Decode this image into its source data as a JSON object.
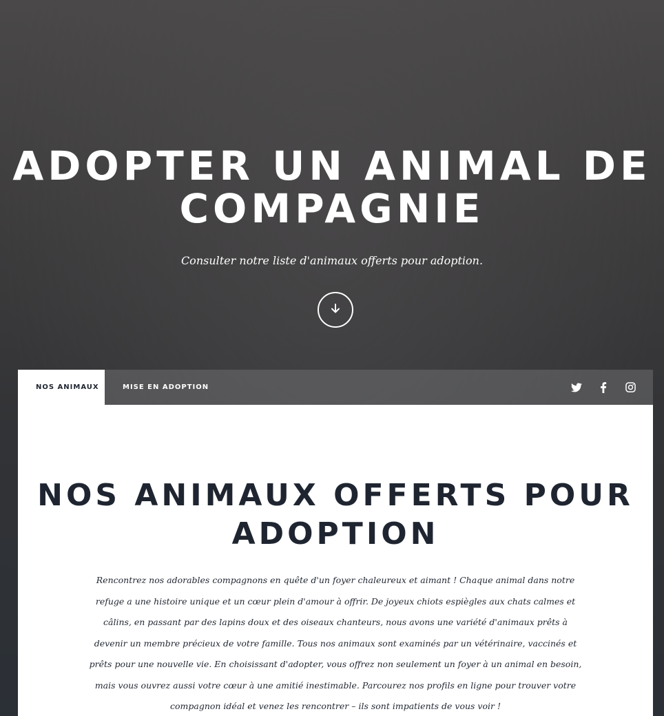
{
  "hero": {
    "title": "ADOPTER UN ANIMAL DE COMPAGNIE",
    "subtitle": "Consulter notre liste d'animaux offerts pour adoption.",
    "scroll_icon": "arrow-down-icon"
  },
  "nav": {
    "tabs": [
      {
        "label": "NOS ANIMAUX",
        "active": true
      },
      {
        "label": "MISE EN ADOPTION",
        "active": false
      }
    ],
    "social": [
      "twitter-icon",
      "facebook-icon",
      "instagram-icon"
    ]
  },
  "section": {
    "title": "NOS ANIMAUX OFFERTS POUR ADOPTION",
    "body": "Rencontrez nos adorables compagnons en quête d'un foyer chaleureux et aimant ! Chaque animal dans notre refuge a une histoire unique et un cœur plein d'amour à offrir. De joyeux chiots espiègles aux chats calmes et câlins, en passant par des lapins doux et des oiseaux chanteurs, nous avons une variété d'animaux prêts à devenir un membre précieux de votre famille. Tous nos animaux sont examinés par un vétérinaire, vaccinés et prêts pour une nouvelle vie. En choisissant d'adopter, vous offrez non seulement un foyer à un animal en besoin, mais vous ouvrez aussi votre cœur à une amitié inestimable. Parcourez nos profils en ligne pour trouver votre compagnon idéal et venez les rencontrer – ils sont impatients de vous voir !"
  },
  "colors": {
    "text_dark": "#1f2530",
    "white": "#ffffff"
  }
}
